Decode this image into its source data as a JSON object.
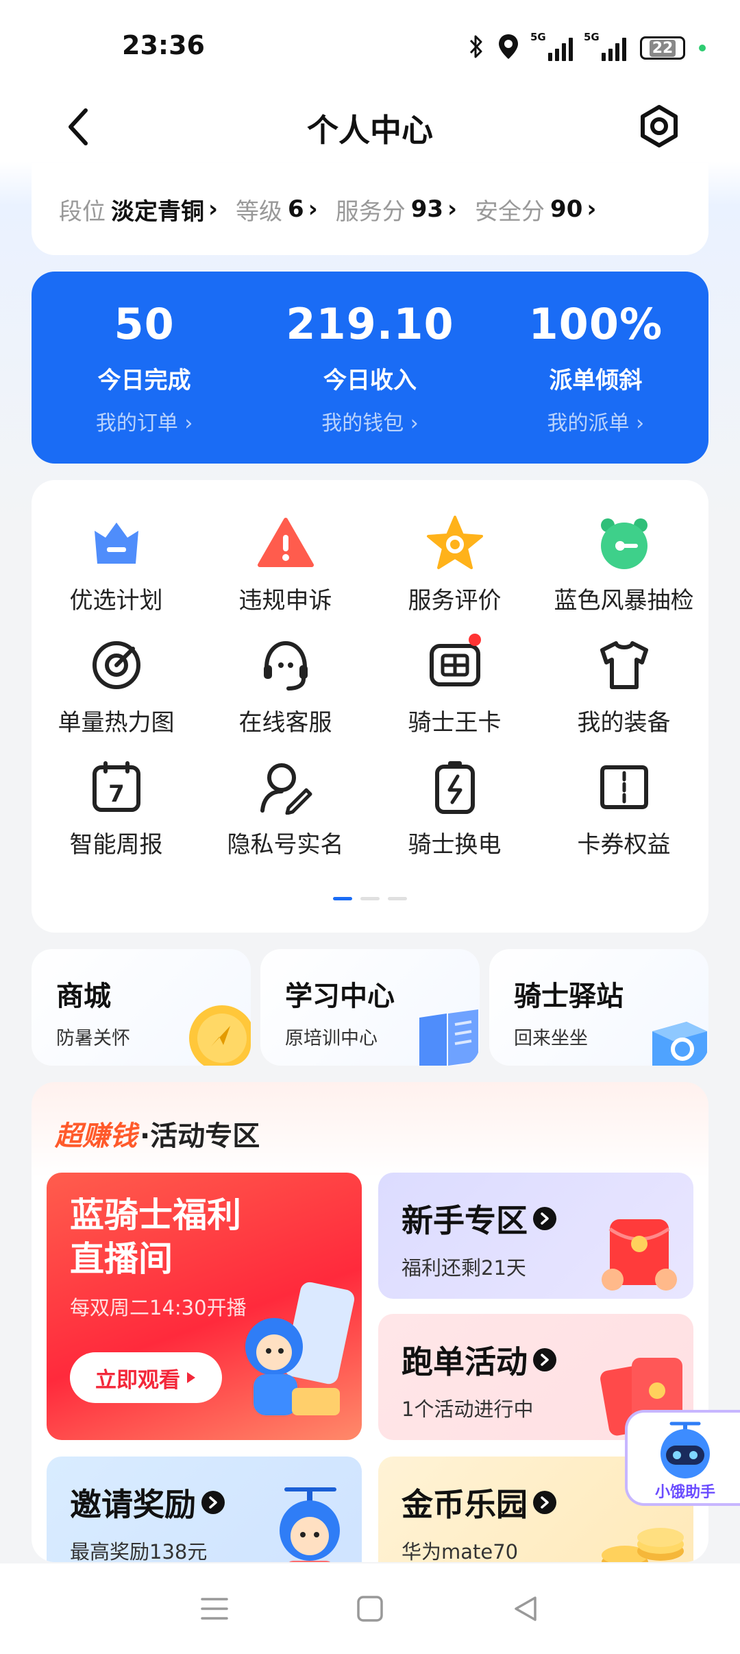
{
  "status_bar": {
    "time": "23:36",
    "network1": "5G",
    "network2": "5G",
    "battery": "22"
  },
  "header": {
    "title": "个人中心"
  },
  "rank": [
    {
      "label": "段位",
      "value": "淡定青铜"
    },
    {
      "label": "等级",
      "value": "6"
    },
    {
      "label": "服务分",
      "value": "93"
    },
    {
      "label": "安全分",
      "value": "90"
    }
  ],
  "stats": [
    {
      "value": "50",
      "label": "今日完成",
      "link": "我的订单 ›"
    },
    {
      "value": "219.10",
      "label": "今日收入",
      "link": "我的钱包 ›"
    },
    {
      "value": "100%",
      "label": "派单倾斜",
      "link": "我的派单 ›"
    }
  ],
  "grid": [
    {
      "label": "优选计划",
      "icon": "crown-icon"
    },
    {
      "label": "违规申诉",
      "icon": "warning-icon"
    },
    {
      "label": "服务评价",
      "icon": "star-icon"
    },
    {
      "label": "蓝色风暴抽检",
      "icon": "alarm-clock-icon"
    },
    {
      "label": "单量热力图",
      "icon": "target-icon"
    },
    {
      "label": "在线客服",
      "icon": "headset-icon"
    },
    {
      "label": "骑士王卡",
      "icon": "sim-card-icon"
    },
    {
      "label": "我的装备",
      "icon": "tshirt-icon"
    },
    {
      "label": "智能周报",
      "icon": "calendar-icon"
    },
    {
      "label": "隐私号实名",
      "icon": "user-edit-icon"
    },
    {
      "label": "骑士换电",
      "icon": "battery-swap-icon"
    },
    {
      "label": "卡券权益",
      "icon": "coupon-icon"
    }
  ],
  "tiles": [
    {
      "title": "商城",
      "sub": "防暑关怀"
    },
    {
      "title": "学习中心",
      "sub": "原培训中心"
    },
    {
      "title": "骑士驿站",
      "sub": "回来坐坐"
    }
  ],
  "activity": {
    "hot": "超赚钱",
    "title": "·活动专区",
    "live": {
      "title_line1": "蓝骑士福利",
      "title_line2": "直播间",
      "sub": "每双周二14:30开播",
      "button": "立即观看"
    },
    "newbie": {
      "title": "新手专区",
      "sub": "福利还剩21天"
    },
    "running": {
      "title": "跑单活动",
      "sub": "1个活动进行中"
    },
    "invite": {
      "title": "邀请奖励",
      "sub": "最高奖励138元"
    },
    "coins": {
      "title": "金币乐园",
      "sub": "华为mate70"
    }
  },
  "assistant": {
    "label": "小饿助手"
  },
  "colors": {
    "primary": "#1a6cf5",
    "hot": "#ff5a2b",
    "live_red": "#ff2a3c"
  }
}
